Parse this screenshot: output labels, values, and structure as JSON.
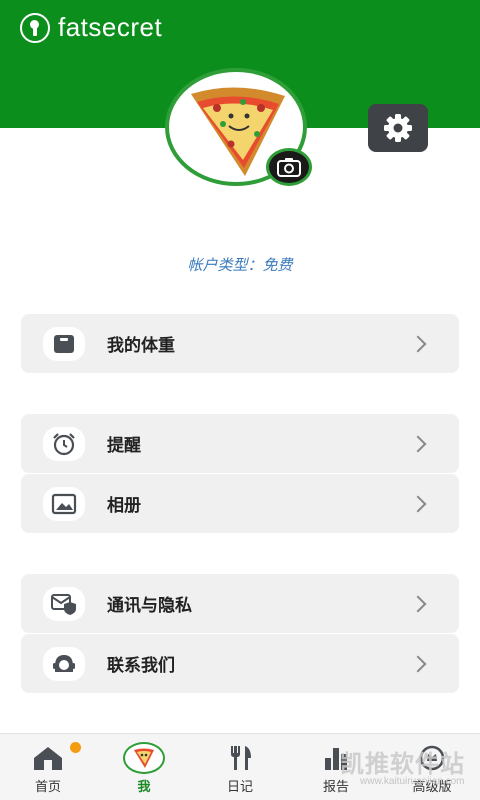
{
  "header": {
    "brand_name": "fatsecret",
    "brand_color": "#0c8e1d"
  },
  "profile": {
    "account_type": "帐户类型：免费",
    "avatar_icon": "pizza-avatar",
    "camera_icon": "camera-icon",
    "settings_icon": "gear-icon"
  },
  "menu": {
    "weight": {
      "label": "我的体重",
      "icon": "scale-icon"
    },
    "reminders": {
      "label": "提醒",
      "icon": "alarm-clock-icon"
    },
    "album": {
      "label": "相册",
      "icon": "image-icon"
    },
    "privacy": {
      "label": "通讯与隐私",
      "icon": "mail-shield-icon"
    },
    "contact": {
      "label": "联系我们",
      "icon": "support-agent-icon"
    }
  },
  "tabbar": {
    "active": "me",
    "tabs": [
      {
        "id": "home",
        "label": "首页",
        "icon": "home-icon",
        "badge": true
      },
      {
        "id": "me",
        "label": "我",
        "icon": "pizza-avatar-icon"
      },
      {
        "id": "diary",
        "label": "日记",
        "icon": "fork-knife-icon"
      },
      {
        "id": "reports",
        "label": "报告",
        "icon": "bar-chart-icon"
      },
      {
        "id": "premium",
        "label": "高级版",
        "icon": "premium-icon"
      }
    ]
  },
  "watermark": {
    "text": "凯推软件站",
    "url": "www.kaituiruanjian.com"
  }
}
